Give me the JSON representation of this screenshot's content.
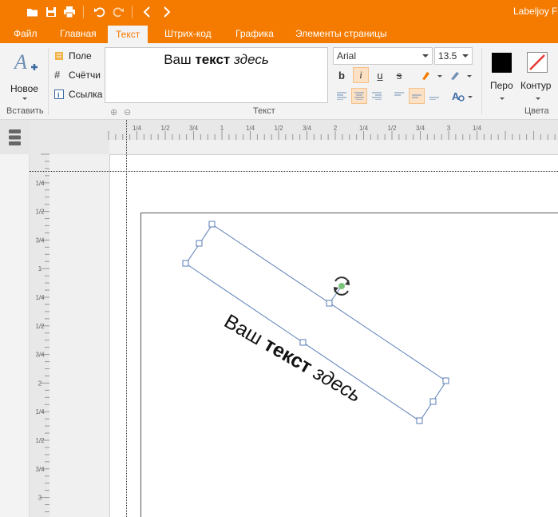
{
  "app": {
    "title": "Labeljoy Fu"
  },
  "quick_access": {
    "open_icon": "folder-open-icon",
    "save_icon": "save-icon",
    "print_icon": "print-icon",
    "undo_icon": "undo-icon",
    "redo_icon": "redo-icon",
    "back_icon": "chevron-left-icon",
    "forward_icon": "chevron-right-icon"
  },
  "tabs": [
    {
      "label": "Файл"
    },
    {
      "label": "Главная"
    },
    {
      "label": "Текст"
    },
    {
      "label": "Штрих-код"
    },
    {
      "label": "Графика"
    },
    {
      "label": "Элементы страницы"
    }
  ],
  "ribbon": {
    "insert_group": {
      "new_label": "Новое",
      "group_label": "Вставить"
    },
    "fields": {
      "field_label": "Поле",
      "counter_label": "Счётчи",
      "link_label": "Ссылка"
    },
    "text_group": {
      "preview_normal": "Ваш ",
      "preview_bold": "текст",
      "preview_italic": " здесь",
      "font": "Arial",
      "size": "13.5",
      "group_label": "Текст"
    },
    "colors_group": {
      "pen_label": "Перо",
      "outline_label": "Контур",
      "group_label": "Цвета",
      "pen_color": "#000000",
      "outline_color": "#e53935"
    }
  },
  "ruler": {
    "h_labels": [
      "1/4",
      "1/2",
      "3/4",
      "1",
      "1/4",
      "1/2",
      "3/4",
      "2",
      "1/4",
      "1/2",
      "3/4",
      "3",
      "1/4"
    ],
    "v_labels": [
      "1/4",
      "1/2",
      "3/4",
      "1",
      "1/4",
      "1/2",
      "3/4",
      "2",
      "1/4",
      "1/2",
      "3/4",
      "3"
    ]
  },
  "canvas": {
    "text_normal": "Ваш ",
    "text_bold": "текст",
    "text_italic": " здесь"
  },
  "colors": {
    "accent": "#f47a00"
  }
}
